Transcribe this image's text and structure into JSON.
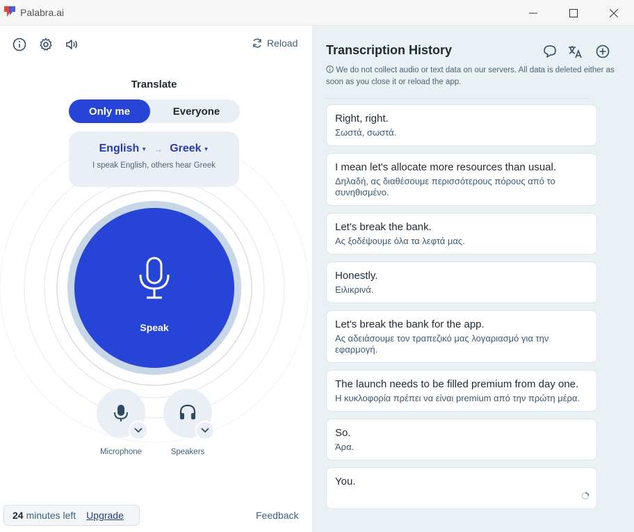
{
  "window": {
    "title": "Palabra.ai"
  },
  "toolbar": {
    "reload_label": "Reload"
  },
  "translate": {
    "label": "Translate",
    "mode_only_me": "Only me",
    "mode_everyone": "Everyone",
    "source_lang": "English",
    "target_lang": "Greek",
    "description": "I speak English, others hear Greek"
  },
  "speak": {
    "label": "Speak"
  },
  "devices": {
    "microphone_label": "Microphone",
    "speakers_label": "Speakers"
  },
  "footer": {
    "minutes_value": "24",
    "minutes_suffix": "minutes left",
    "upgrade_label": "Upgrade",
    "feedback_label": "Feedback"
  },
  "history": {
    "title": "Transcription History",
    "notice": "We do not collect audio or text data on our servers. All data is deleted either as soon as you close it or reload the app.",
    "items": [
      {
        "source": "Right, right.",
        "translation": "Σωστά, σωστά."
      },
      {
        "source": "I mean let's allocate more resources than usual.",
        "translation": "Δηλαδή, ας διαθέσουμε περισσότερους πόρους από το συνηθισμένο."
      },
      {
        "source": "Let's break the bank.",
        "translation": "Ας ξοδέψουμε όλα τα λεφτά μας."
      },
      {
        "source": "Honestly.",
        "translation": "Ειλικρινά."
      },
      {
        "source": "Let's break the bank for the app.",
        "translation": "Ας αδειάσουμε τον τραπεζικό μας λογαριασμό για την εφαρμογή."
      },
      {
        "source": "The launch needs to be filled premium from day one.",
        "translation": "Η κυκλοφορία πρέπει να είναι premium από την πρώτη μέρα."
      },
      {
        "source": "So.",
        "translation": "Άρα."
      },
      {
        "source": "You.",
        "translation": ""
      }
    ]
  },
  "colors": {
    "accent": "#2644d6",
    "panel": "#eaf1f5",
    "text": "#1f2a35"
  }
}
